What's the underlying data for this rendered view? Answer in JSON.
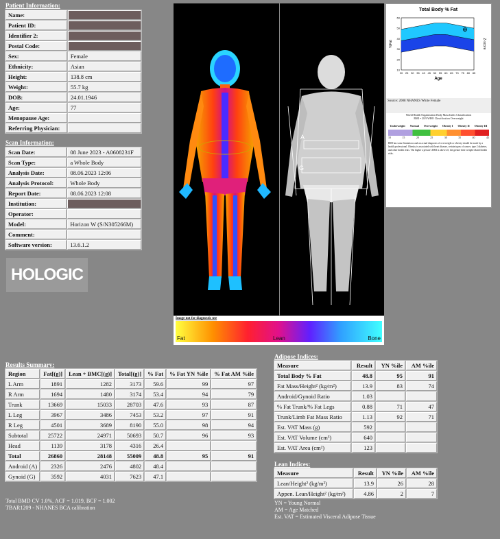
{
  "patient": {
    "title": "Patient Information:",
    "rows": [
      {
        "label": "Name:",
        "value": "",
        "redacted": true
      },
      {
        "label": "Patient ID:",
        "value": "",
        "redacted": true
      },
      {
        "label": "Identifier 2:",
        "value": "",
        "redacted": true
      },
      {
        "label": "Postal Code:",
        "value": "",
        "redacted": true
      },
      {
        "label": "Sex:",
        "value": "Female"
      },
      {
        "label": "Ethnicity:",
        "value": "Asian"
      },
      {
        "label": "Height:",
        "value": "138.8 cm"
      },
      {
        "label": "Weight:",
        "value": "55.7 kg"
      },
      {
        "label": "DOB:",
        "value": "24.01.1946"
      },
      {
        "label": "Age:",
        "value": "77"
      },
      {
        "label": "Menopause Age:",
        "value": ""
      },
      {
        "label": "Referring Physician:",
        "value": ""
      }
    ]
  },
  "scan": {
    "title": "Scan Information:",
    "rows": [
      {
        "label": "Scan Date:",
        "value": "08 June 2023 - A0608231F"
      },
      {
        "label": "Scan Type:",
        "value": "a Whole Body"
      },
      {
        "label": "Analysis Date:",
        "value": "08.06.2023 12:06"
      },
      {
        "label": "Analysis Protocol:",
        "value": "Whole Body"
      },
      {
        "label": "Report Date:",
        "value": "08.06.2023 12:08"
      },
      {
        "label": "Institution:",
        "value": "",
        "redacted": true
      },
      {
        "label": "Operator:",
        "value": ""
      },
      {
        "label": "Model:",
        "value": "Horizon W (S/N305266M)"
      },
      {
        "label": "Comment:",
        "value": ""
      },
      {
        "label": "Software version:",
        "value": "13.6.1.2"
      }
    ]
  },
  "logo": "HOLOGIC",
  "colorbar": {
    "note": "Image not for diagnostic use",
    "fat": "Fat",
    "lean": "Lean",
    "bone": "Bone"
  },
  "scan_labels": {
    "a": "A",
    "g": "G"
  },
  "graph": {
    "title": "Total Body % Fat",
    "ylabel": "%Fat",
    "ylabel2": "Z-score",
    "xlabel": "Age",
    "source": "Source: 2008 NHANES White Female",
    "who_title": "World Health Organization Body Mass Index Classification",
    "who_sub": "BMI = 28.9 WHO Classification Overweight",
    "bmi_cats": [
      "Underweight",
      "Normal",
      "Overweight",
      "Obesity I",
      "Obesity II",
      "Obesity III"
    ],
    "bmi_ticks": [
      "10",
      "15",
      "20",
      "25",
      "30",
      "35",
      "40",
      "45"
    ],
    "bmi_text": "BMI has some limitations and an actual diagnosis of overweight or obesity should be made by a health professional. Obesity is associated with heart disease, certain types of cancer, type 2 diabetes, and other health risks. The higher a person's BMI is above 25, the greater their weight-related health risks."
  },
  "chart_data": {
    "type": "area",
    "title": "Total Body % Fat",
    "xlabel": "Age",
    "ylabel": "%Fat",
    "x": [
      20,
      25,
      30,
      35,
      40,
      45,
      50,
      55,
      60,
      65,
      70,
      75,
      80,
      85
    ],
    "xlim": [
      20,
      85
    ],
    "ylim": [
      10,
      60
    ],
    "series": [
      {
        "values_upper": [
          49,
          50,
          51,
          52,
          53,
          54,
          55,
          55,
          55,
          54,
          53,
          52,
          51,
          50
        ]
      },
      {
        "values_mid": [
          38,
          39,
          40,
          41,
          42,
          43,
          44,
          44,
          44,
          43,
          42,
          41,
          40,
          39
        ]
      },
      {
        "values_lower": [
          27,
          28,
          29,
          30,
          31,
          32,
          33,
          33,
          33,
          32,
          31,
          30,
          29,
          28
        ]
      }
    ],
    "patient_point": {
      "x": 77,
      "y": 48.8
    }
  },
  "results": {
    "title": "Results Summary:",
    "headers": [
      "Region",
      "Fat[(g)]",
      "Lean + BMC[(g)]",
      "Total[(g)]",
      "% Fat",
      "% Fat YN %ile",
      "% Fat AM %ile"
    ],
    "rows": [
      [
        "L Arm",
        "1891",
        "1282",
        "3173",
        "59.6",
        "99",
        "97"
      ],
      [
        "R Arm",
        "1694",
        "1480",
        "3174",
        "53.4",
        "94",
        "79"
      ],
      [
        "Trunk",
        "13669",
        "15033",
        "28703",
        "47.6",
        "93",
        "87"
      ],
      [
        "L Leg",
        "3967",
        "3486",
        "7453",
        "53.2",
        "97",
        "91"
      ],
      [
        "R Leg",
        "4501",
        "3689",
        "8190",
        "55.0",
        "98",
        "94"
      ],
      [
        "Subtotal",
        "25722",
        "24971",
        "50693",
        "50.7",
        "96",
        "93"
      ],
      [
        "Head",
        "1139",
        "3178",
        "4316",
        "26.4",
        "",
        ""
      ],
      [
        "Total",
        "26860",
        "28148",
        "55009",
        "48.8",
        "95",
        "91"
      ],
      [
        "Android (A)",
        "2326",
        "2476",
        "4802",
        "48.4",
        "",
        ""
      ],
      [
        "Gynoid (G)",
        "3592",
        "4031",
        "7623",
        "47.1",
        "",
        ""
      ]
    ],
    "footnote1": "Total BMD CV 1.0%, ACF = 1.019, BCF = 1.002",
    "footnote2": "TBAR1209 - NHANES BCA calibration"
  },
  "adipose": {
    "title": "Adipose Indices:",
    "headers": [
      "Measure",
      "Result",
      "YN %ile",
      "AM %ile"
    ],
    "rows": [
      [
        "Total Body % Fat",
        "48.8",
        "95",
        "91"
      ],
      [
        "Fat Mass/Height² (kg/m²)",
        "13.9",
        "83",
        "74"
      ],
      [
        "Android/Gynoid Ratio",
        "1.03",
        "",
        ""
      ],
      [
        "% Fat Trunk/% Fat Legs",
        "0.88",
        "71",
        "47"
      ],
      [
        "Trunk/Limb Fat Mass Ratio",
        "1.13",
        "92",
        "71"
      ],
      [
        "Est. VAT Mass (g)",
        "592",
        "",
        ""
      ],
      [
        "Est. VAT Volume (cm³)",
        "640",
        "",
        ""
      ],
      [
        "Est. VAT Area (cm²)",
        "123",
        "",
        ""
      ]
    ]
  },
  "lean": {
    "title": "Lean Indices:",
    "headers": [
      "Measure",
      "Result",
      "YN %ile",
      "AM %ile"
    ],
    "rows": [
      [
        "Lean/Height² (kg/m²)",
        "13.9",
        "26",
        "28"
      ],
      [
        "Appen. Lean/Height² (kg/m²)",
        "4.86",
        "2",
        "7"
      ]
    ],
    "note1": "YN = Young Normal",
    "note2": "AM = Age Matched",
    "note3": "Est. VAT = Estimated Visceral Adipose Tissue"
  }
}
